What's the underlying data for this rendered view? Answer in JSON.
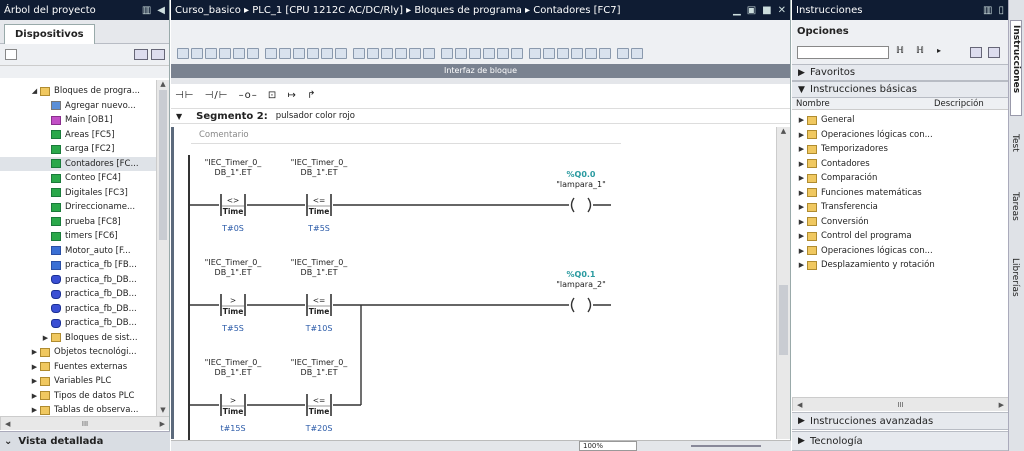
{
  "left_panel": {
    "title": "Árbol del proyecto",
    "tab": "Dispositivos",
    "bottom_title": "Vista detallada",
    "scroll_mid": "III",
    "tree": [
      {
        "label": "Bloques de progra...",
        "indent": 2,
        "expanded": true,
        "icon": "folder",
        "selected": false
      },
      {
        "label": "Agregar nuevo...",
        "indent": 3,
        "icon": "add"
      },
      {
        "label": "Main [OB1]",
        "indent": 3,
        "icon": "ob"
      },
      {
        "label": "Areas [FC5]",
        "indent": 3,
        "icon": "fc"
      },
      {
        "label": "carga [FC2]",
        "indent": 3,
        "icon": "fc"
      },
      {
        "label": "Contadores [FC...",
        "indent": 3,
        "icon": "fc",
        "selected": true
      },
      {
        "label": "Conteo [FC4]",
        "indent": 3,
        "icon": "fc"
      },
      {
        "label": "Digitales [FC3]",
        "indent": 3,
        "icon": "fc"
      },
      {
        "label": "Drireccioname...",
        "indent": 3,
        "icon": "fc"
      },
      {
        "label": "prueba [FC8]",
        "indent": 3,
        "icon": "fc"
      },
      {
        "label": "timers [FC6]",
        "indent": 3,
        "icon": "fc"
      },
      {
        "label": "Motor_auto [F...",
        "indent": 3,
        "icon": "fb"
      },
      {
        "label": "practica_fb [FB...",
        "indent": 3,
        "icon": "fb"
      },
      {
        "label": "practica_fb_DB...",
        "indent": 3,
        "icon": "db"
      },
      {
        "label": "practica_fb_DB...",
        "indent": 3,
        "icon": "db"
      },
      {
        "label": "practica_fb_DB...",
        "indent": 3,
        "icon": "db"
      },
      {
        "label": "practica_fb_DB...",
        "indent": 3,
        "icon": "db"
      },
      {
        "label": "Bloques de sist...",
        "indent": 3,
        "expandable": true,
        "icon": "folder"
      },
      {
        "label": "Objetos tecnológi...",
        "indent": 2,
        "expandable": true,
        "icon": "folder"
      },
      {
        "label": "Fuentes externas",
        "indent": 2,
        "expandable": true,
        "icon": "folder"
      },
      {
        "label": "Variables PLC",
        "indent": 2,
        "expandable": true,
        "icon": "folder"
      },
      {
        "label": "Tipos de datos PLC",
        "indent": 2,
        "expandable": true,
        "icon": "folder"
      },
      {
        "label": "Tablas de observa...",
        "indent": 2,
        "expandable": true,
        "icon": "folder"
      }
    ]
  },
  "editor": {
    "breadcrumb": [
      "Curso_basico",
      "PLC_1 [CPU 1212C AC/DC/Rly]",
      "Bloques de programa",
      "Contadores [FC7]"
    ],
    "interface_label": "Interfaz de bloque",
    "segment_title": "Segmento 2:",
    "segment_comment": "pulsador color rojo",
    "comment_placeholder": "Comentario",
    "zoom": "100%",
    "rungs": [
      {
        "contacts": [
          {
            "var1": "\"IEC_Timer_0_",
            "var2": "DB_1\".ET",
            "op": "<>",
            "type": "Time",
            "val": "T#0S"
          },
          {
            "var1": "\"IEC_Timer_0_",
            "var2": "DB_1\".ET",
            "op": "<=",
            "type": "Time",
            "val": "T#5S"
          }
        ],
        "coil_addr": "%Q0.0",
        "coil_name": "\"lampara_1\""
      },
      {
        "contacts": [
          {
            "var1": "\"IEC_Timer_0_",
            "var2": "DB_1\".ET",
            "op": ">",
            "type": "Time",
            "val": "T#5S"
          },
          {
            "var1": "\"IEC_Timer_0_",
            "var2": "DB_1\".ET",
            "op": "<=",
            "type": "Time",
            "val": "T#10S"
          }
        ],
        "coil_addr": "%Q0.1",
        "coil_name": "\"lampara_2\""
      },
      {
        "contacts": [
          {
            "var1": "\"IEC_Timer_0_",
            "var2": "DB_1\".ET",
            "op": ">",
            "type": "Time",
            "val": "t#15S"
          },
          {
            "var1": "\"IEC_Timer_0_",
            "var2": "DB_1\".ET",
            "op": "<=",
            "type": "Time",
            "val": "T#20S"
          }
        ]
      }
    ]
  },
  "right_panel": {
    "title": "Instrucciones",
    "options_label": "Opciones",
    "favorites": "Favoritos",
    "basic": "Instrucciones básicas",
    "col_name": "Nombre",
    "col_desc": "Descripción",
    "items": [
      "General",
      "Operaciones lógicas con...",
      "Temporizadores",
      "Contadores",
      "Comparación",
      "Funciones matemáticas",
      "Transferencia",
      "Conversión",
      "Control del programa",
      "Operaciones lógicas con...",
      "Desplazamiento y rotación"
    ],
    "advanced": "Instrucciones avanzadas",
    "technology": "Tecnología",
    "scroll_mid": "III",
    "side_tabs": [
      "Instrucciones",
      "Test",
      "Tareas",
      "Librerías"
    ]
  }
}
